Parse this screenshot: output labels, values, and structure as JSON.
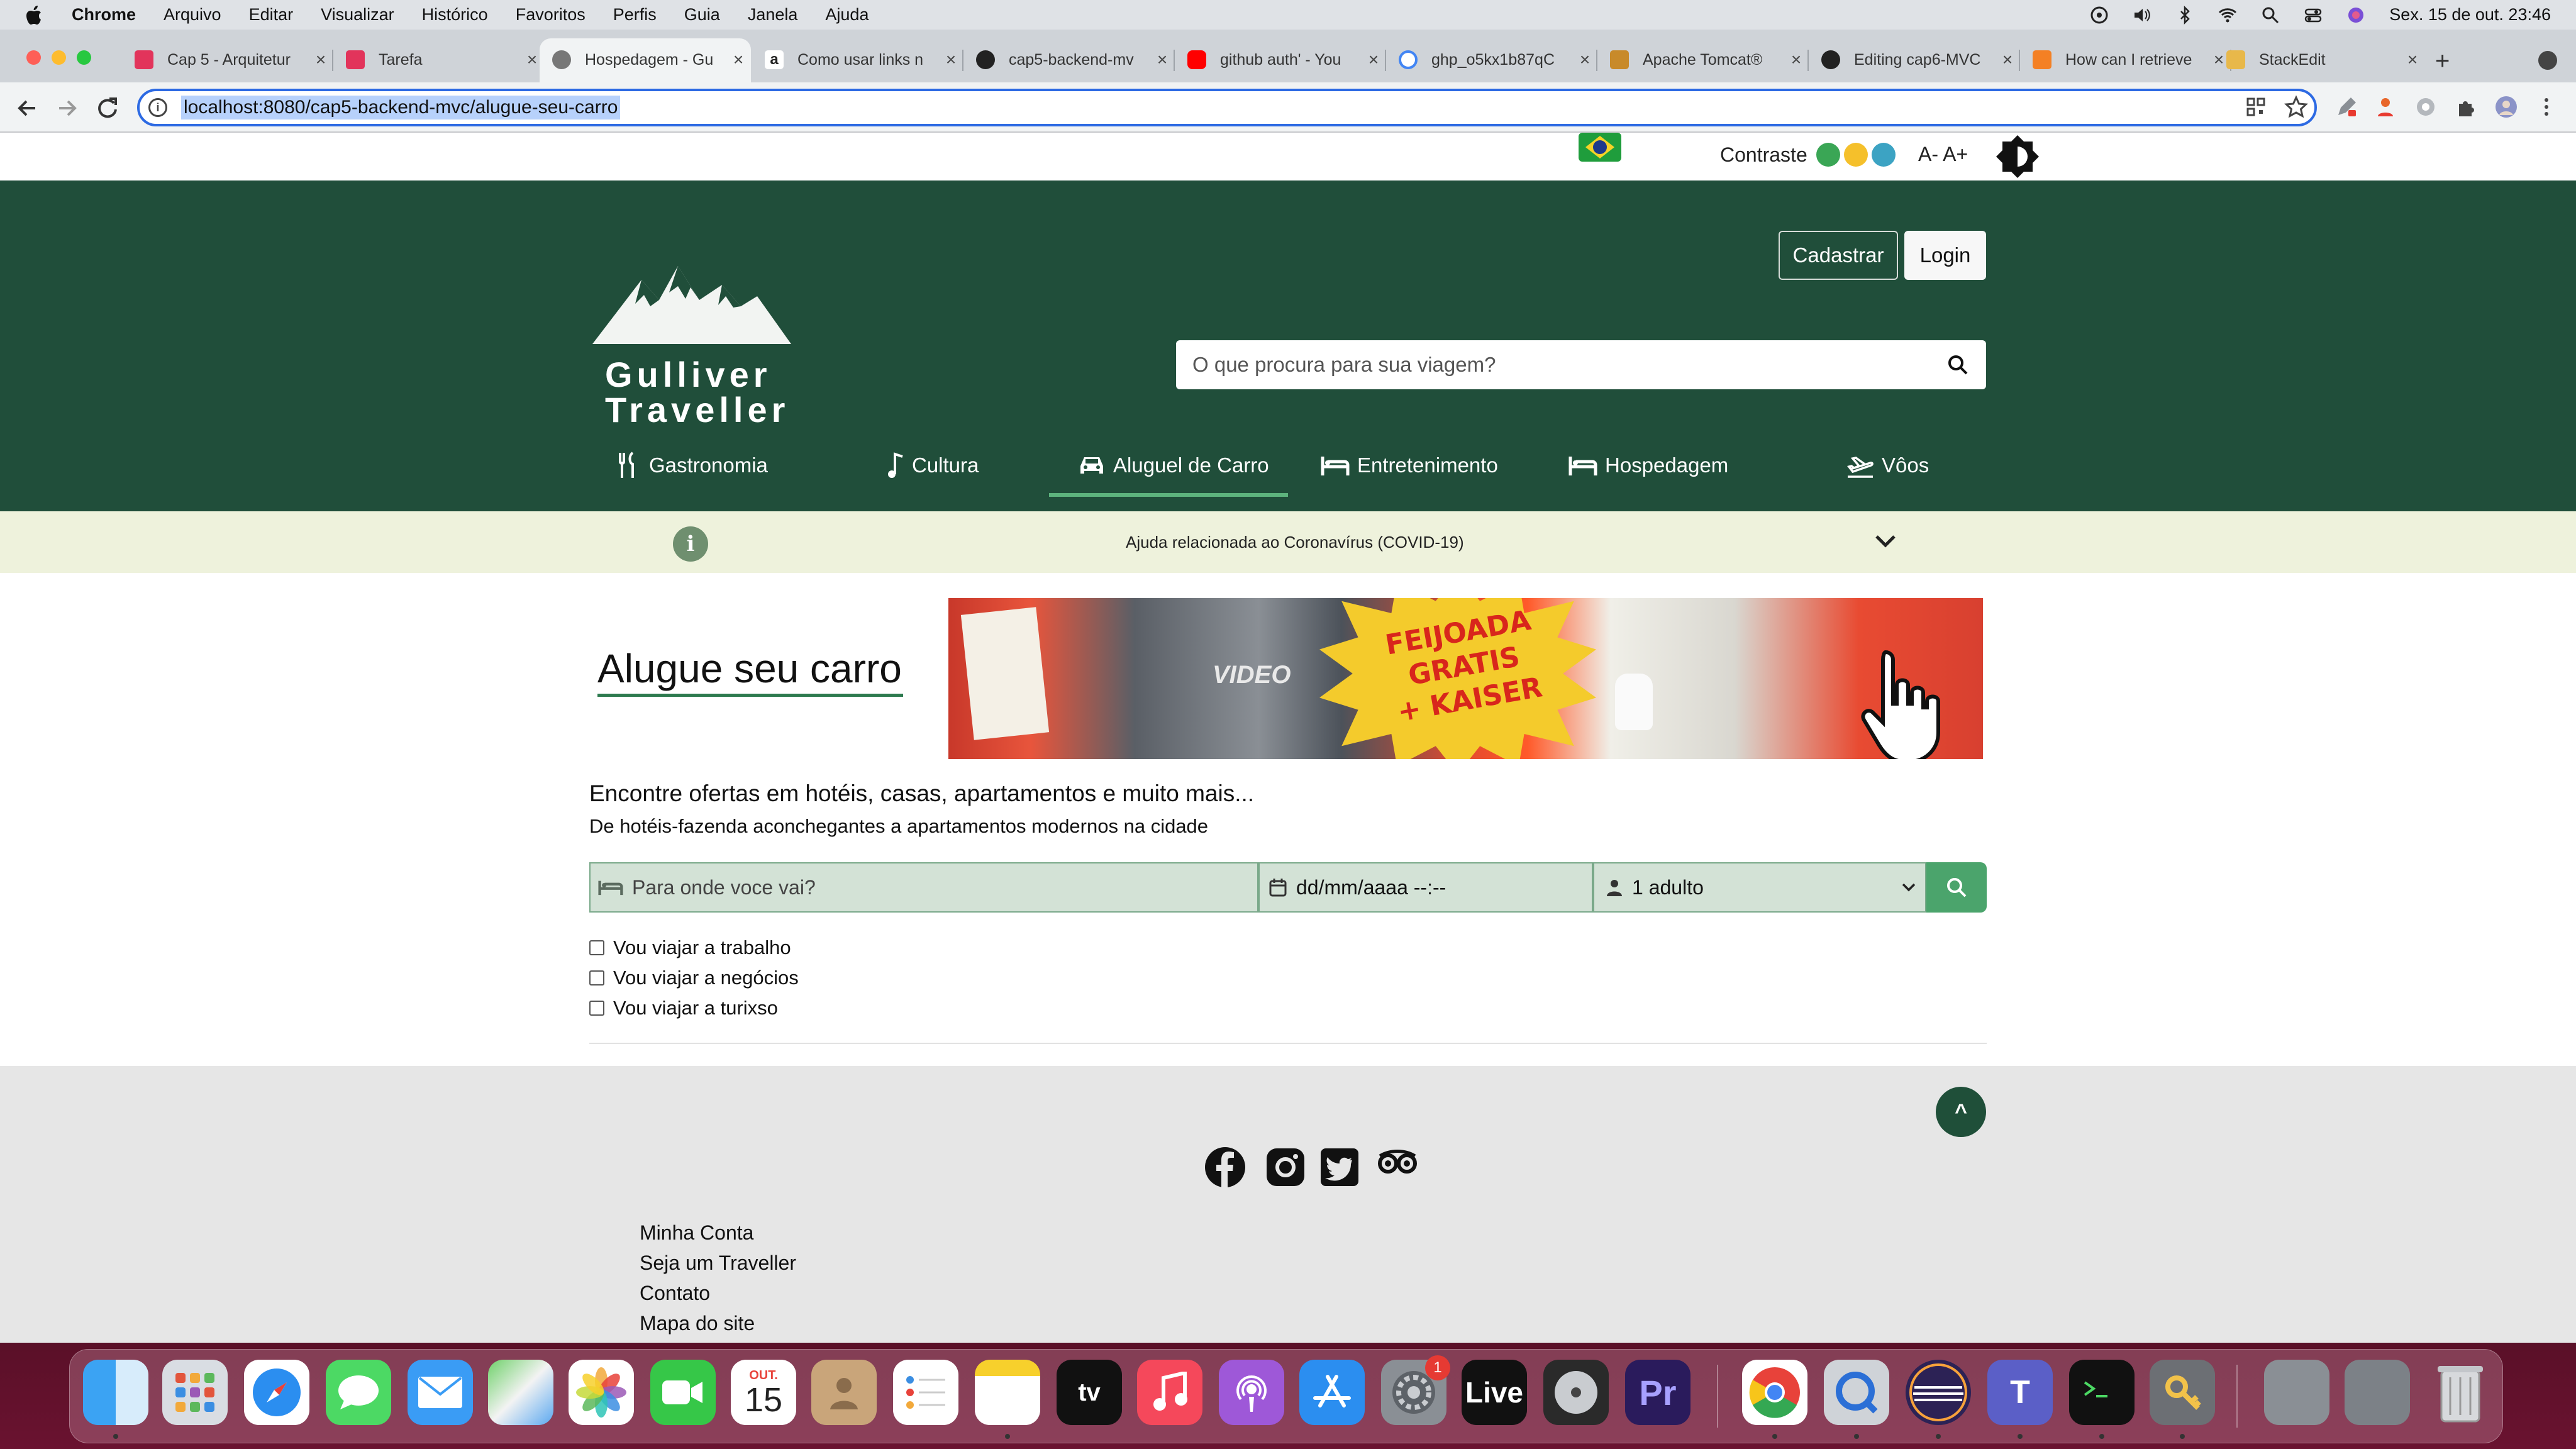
{
  "menubar": {
    "app": "Chrome",
    "items": [
      "Arquivo",
      "Editar",
      "Visualizar",
      "Histórico",
      "Favoritos",
      "Perfis",
      "Guia",
      "Janela",
      "Ajuda"
    ],
    "datetime": "Sex. 15 de out.  23:46"
  },
  "tabs": [
    {
      "title": "Cap 5 - Arquitetur",
      "fav_color": "#e2345b"
    },
    {
      "title": "Tarefa",
      "fav_color": "#e2345b"
    },
    {
      "title": "Hospedagem - Gu",
      "fav_color": "#777777"
    },
    {
      "title": "Como usar links n",
      "fav_color": "#222222"
    },
    {
      "title": "cap5-backend-mv",
      "fav_color": "#222222"
    },
    {
      "title": "github auth' - You",
      "fav_color": "#ff0000"
    },
    {
      "title": "ghp_o5kx1b87qC",
      "fav_color": "#4285f4"
    },
    {
      "title": "Apache Tomcat®",
      "fav_color": "#c88a2a"
    },
    {
      "title": "Editing cap6-MVC",
      "fav_color": "#222222"
    },
    {
      "title": "How can I retrieve",
      "fav_color": "#f48024"
    },
    {
      "title": "StackEdit",
      "fav_color": "#e8b84a"
    }
  ],
  "browser": {
    "url": "localhost:8080/cap5-backend-mvc/alugue-seu-carro"
  },
  "accessibility": {
    "contrast_label": "Contraste",
    "contrast_colors": [
      "#3aa655",
      "#f5c02b",
      "#3ca3c3"
    ],
    "font_size_label": "A- A+"
  },
  "header": {
    "brand_line1": "Gulliver",
    "brand_line2": "Traveller",
    "signup_label": "Cadastrar",
    "login_label": "Login",
    "search_placeholder": "O que procura para sua viagem?",
    "nav": [
      {
        "label": "Gastronomia",
        "icon": "utensils-icon"
      },
      {
        "label": "Cultura",
        "icon": "music-note-icon"
      },
      {
        "label": "Aluguel de Carro",
        "icon": "car-icon",
        "active": true
      },
      {
        "label": "Entretenimento",
        "icon": "bed-icon"
      },
      {
        "label": "Hospedagem",
        "icon": "bed-icon"
      },
      {
        "label": "Vôos",
        "icon": "plane-icon"
      }
    ],
    "brand_color": "#204e3a"
  },
  "covid": {
    "text": "Ajuda relacionada ao Coronavírus (COVID-19)"
  },
  "hero": {
    "title": "Alugue seu carro",
    "promo_line1": "FEIJOADA",
    "promo_line2": "GRATIS",
    "promo_line3": "+ KAISER",
    "video_text": "VIDEO"
  },
  "search_form": {
    "heading": "Encontre ofertas em hotéis, casas, apartamentos e muito mais...",
    "subheading": "De hotéis-fazenda aconchegantes a apartamentos modernos na cidade",
    "destination_placeholder": "Para onde voce vai?",
    "date_value": "dd/mm/aaaa --:--",
    "guests_value": "1 adulto",
    "checkboxes": [
      "Vou viajar a trabalho",
      "Vou viajar a negócios",
      "Vou viajar a turixso"
    ]
  },
  "footer": {
    "back_to_top": "^",
    "social": [
      "facebook-icon",
      "instagram-icon",
      "twitter-icon",
      "tripadvisor-icon"
    ],
    "links": [
      "Minha Conta",
      "Seja um Traveller",
      "Contato",
      "Mapa do site"
    ]
  },
  "dock": {
    "calendar_month": "OUT.",
    "calendar_day": "15",
    "settings_badge": "1",
    "tv_label": "tv",
    "live_label": "Live",
    "premiere_label": "Pr"
  }
}
